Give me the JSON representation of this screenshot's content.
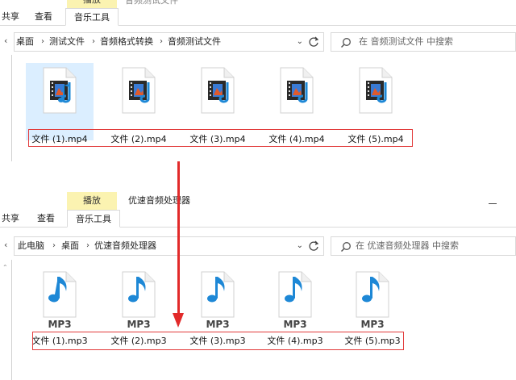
{
  "window1": {
    "context_tab": "播放",
    "title": "音频测试文件",
    "ribbon_tabs": [
      "共享",
      "查看",
      "音乐工具"
    ],
    "breadcrumbs": [
      "桌面",
      "测试文件",
      "音频格式转换",
      "音频测试文件"
    ],
    "search_placeholder": "在 音频测试文件 中搜索",
    "files": [
      "文件 (1).mp4",
      "文件 (2).mp4",
      "文件 (3).mp4",
      "文件 (4).mp4",
      "文件 (5).mp4"
    ]
  },
  "window2": {
    "context_tab": "播放",
    "title": "优速音频处理器",
    "ribbon_tabs": [
      "共享",
      "查看",
      "音乐工具"
    ],
    "breadcrumbs": [
      "此电脑",
      "桌面",
      "优速音频处理器"
    ],
    "search_placeholder": "在 优速音频处理器 中搜索",
    "files": [
      "文件 (1).mp3",
      "文件 (2).mp3",
      "文件 (3).mp3",
      "文件 (4).mp3",
      "文件 (5).mp3"
    ],
    "icon_text": "MP3"
  },
  "icons": {
    "video": "video-audio-file-icon",
    "mp3": "mp3-file-icon",
    "search": "search-icon",
    "refresh": "refresh-icon"
  },
  "colors": {
    "context_tab": "#fbf3b1",
    "highlight": "#e23b3b",
    "arrow": "#e22a2a",
    "note_blue": "#1e88d6",
    "selection": "#dbeeff"
  }
}
